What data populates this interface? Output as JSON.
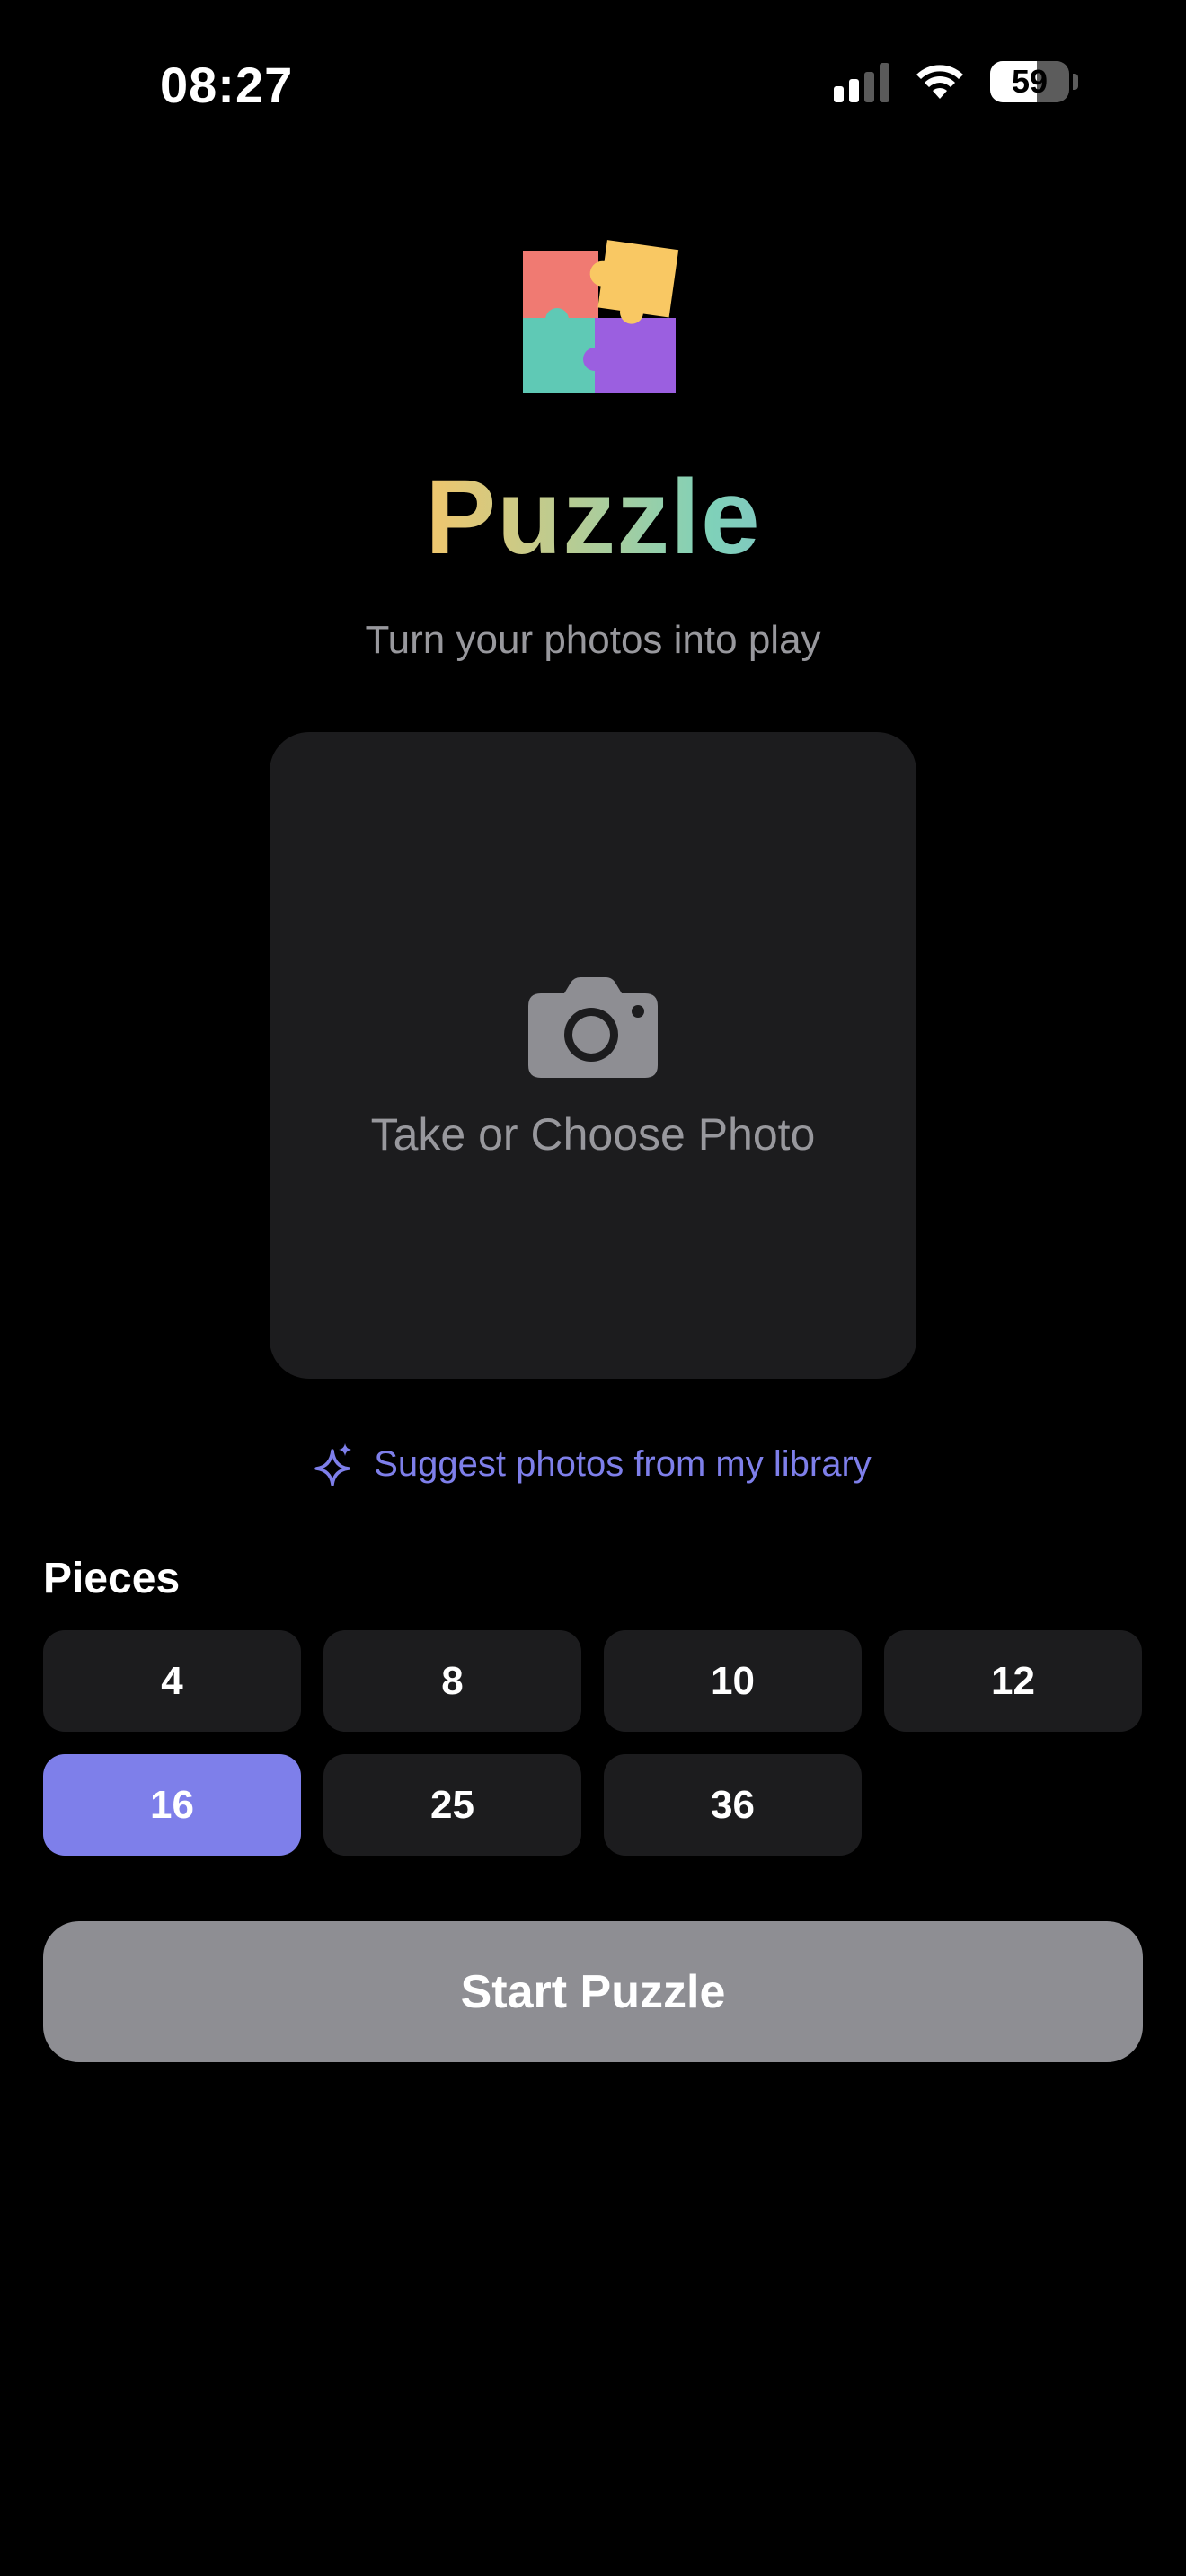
{
  "status_bar": {
    "time": "08:27",
    "battery_level": "59",
    "battery_fraction": 0.59
  },
  "app": {
    "title": "Puzzle",
    "subtitle": "Turn your photos into play"
  },
  "photo_picker": {
    "label": "Take or Choose Photo",
    "icon": "camera-icon"
  },
  "suggest": {
    "label": "Suggest photos from my library",
    "icon": "sparkle-icon"
  },
  "pieces": {
    "label": "Pieces",
    "options": [
      "4",
      "8",
      "10",
      "12",
      "16",
      "25",
      "36"
    ],
    "selected": "16"
  },
  "start_button": {
    "label": "Start Puzzle"
  },
  "colors": {
    "accent": "#7e7fea",
    "card_bg": "#1c1c1e",
    "secondary_text": "#98989d",
    "disabled_button": "#8e8e93",
    "logo_red": "#f07a72",
    "logo_yellow": "#f9c863",
    "logo_teal": "#5fc9b5",
    "logo_purple": "#9b5fe0"
  }
}
